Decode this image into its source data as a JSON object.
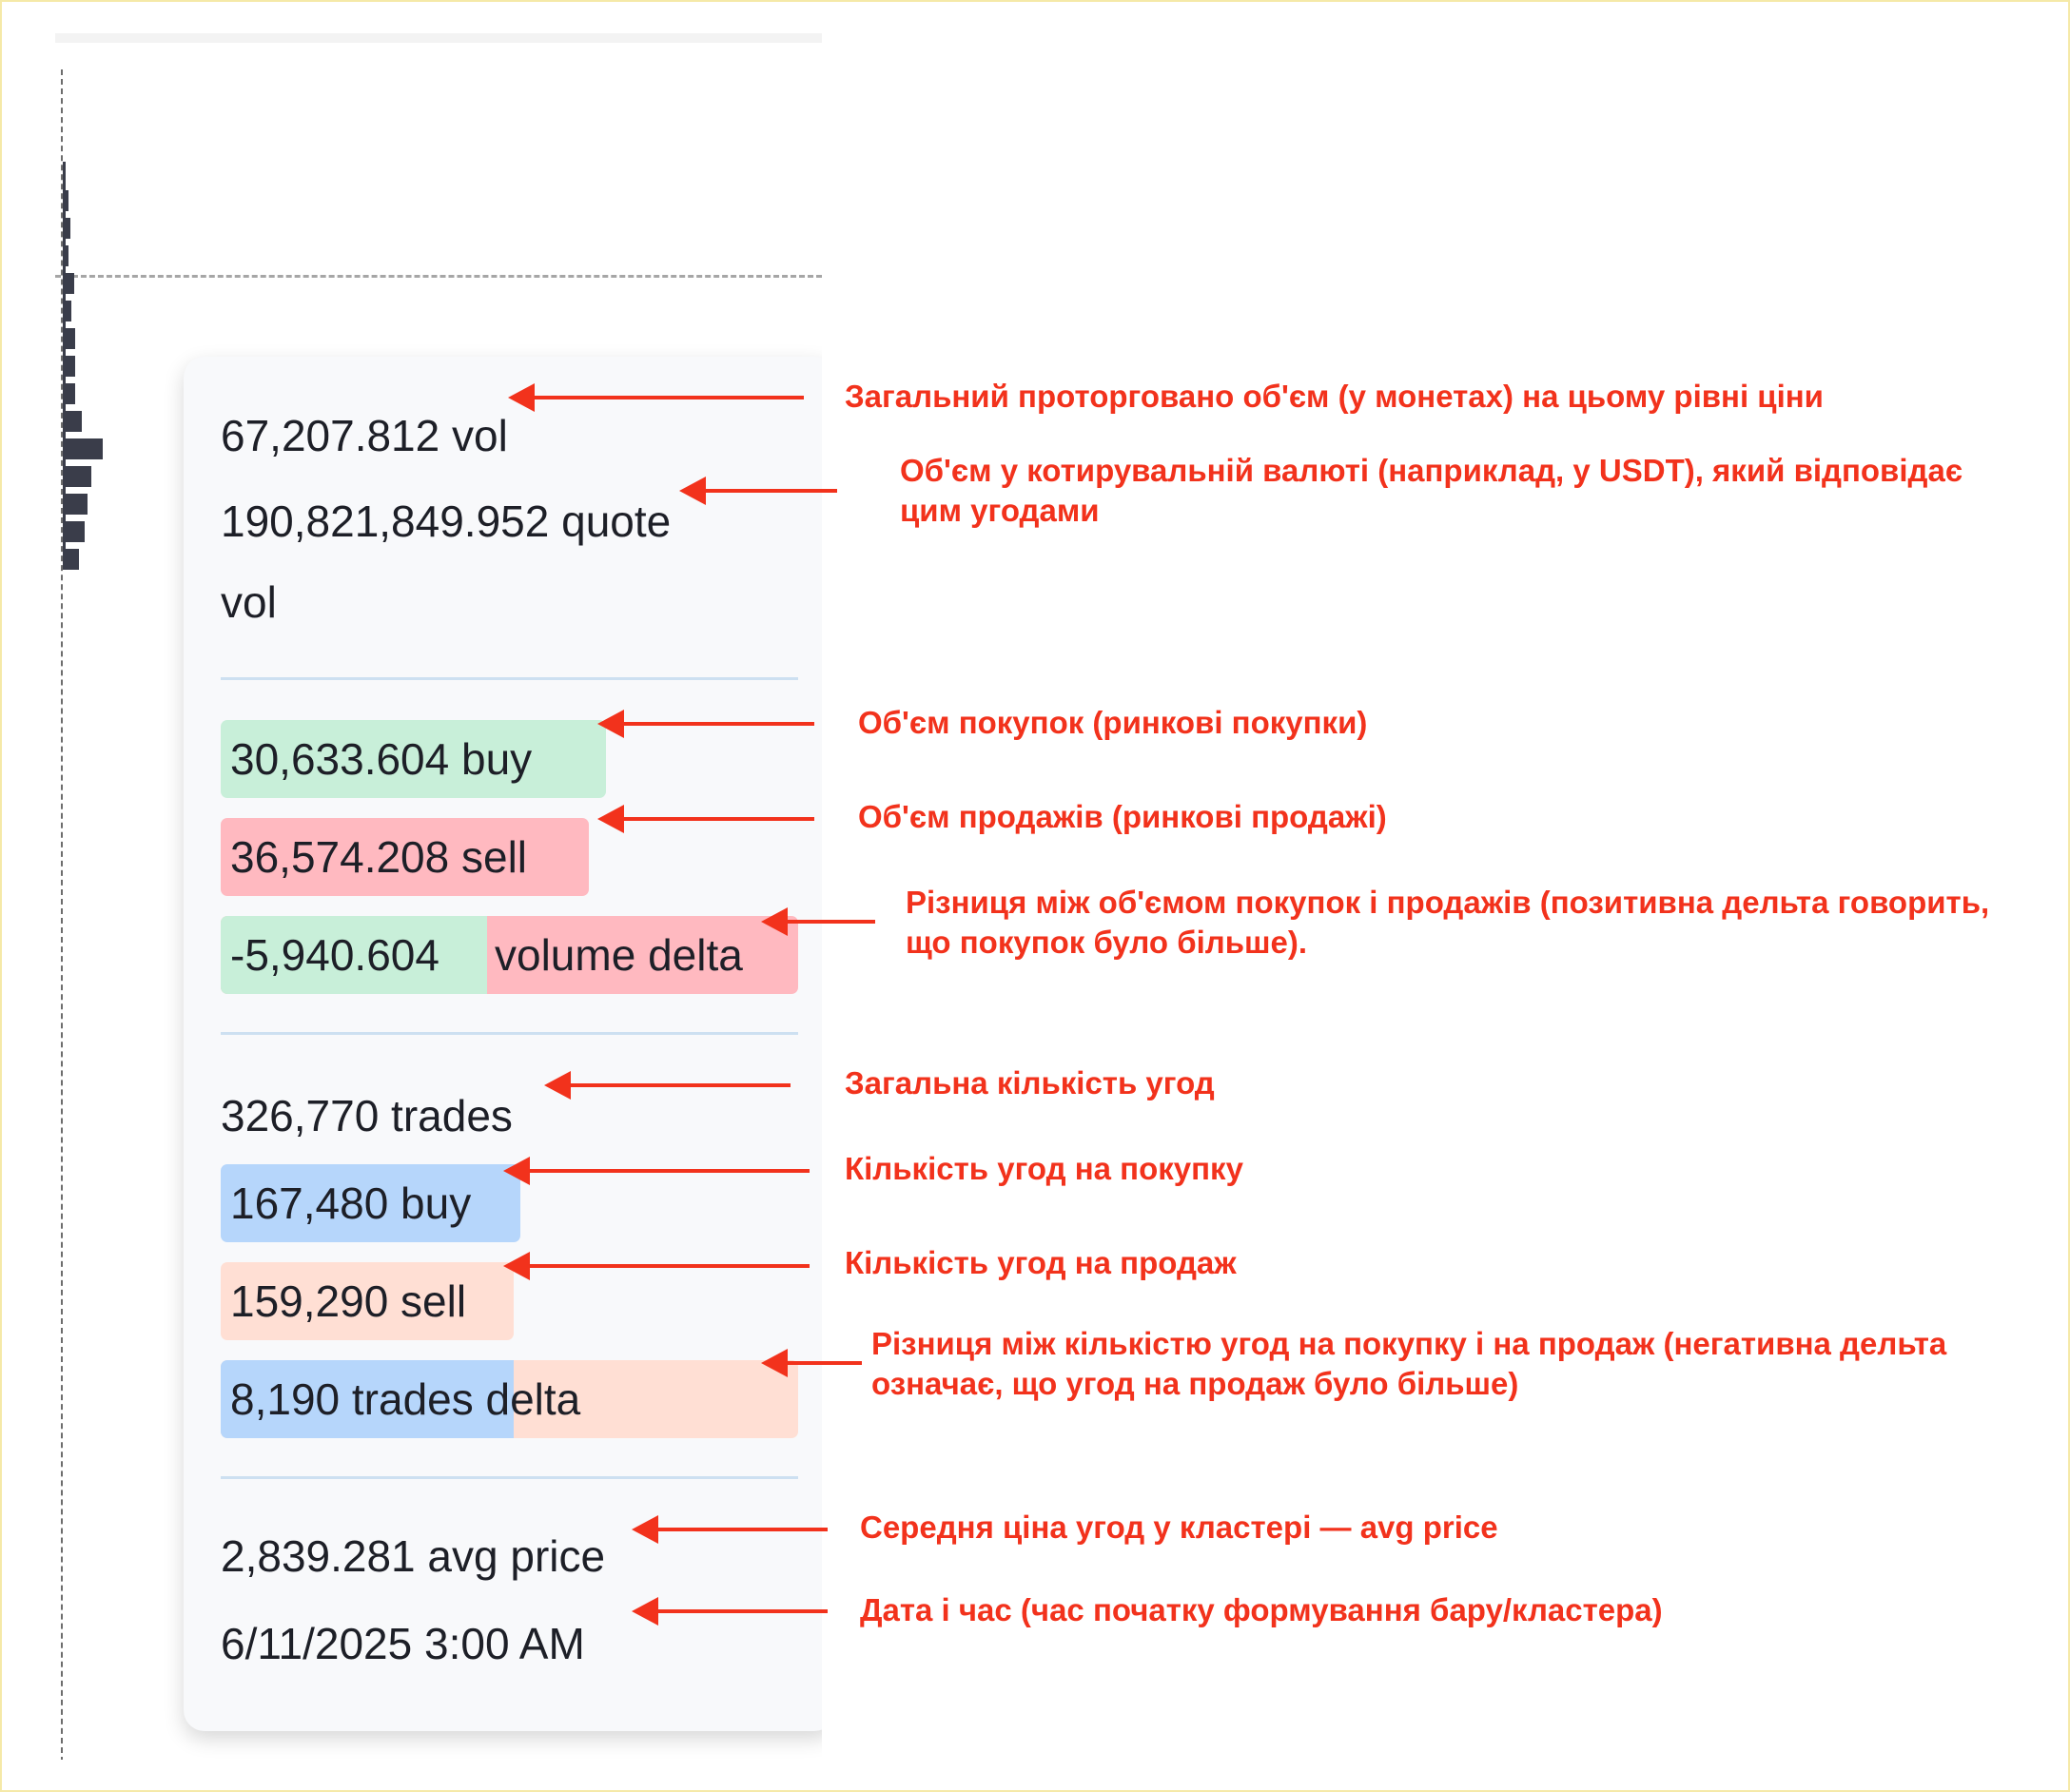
{
  "tooltip": {
    "vol": "67,207.812 vol",
    "quote_vol_line1": "190,821,849.952 quote",
    "quote_vol_line2": "vol",
    "buy_volume": "30,633.604 buy",
    "sell_volume": "36,574.208 sell",
    "volume_delta_value": "-5,940.604",
    "volume_delta_label": "volume delta",
    "trades": "326,770 trades",
    "buy_trades": "167,480 buy",
    "sell_trades": "159,290 sell",
    "trades_delta": "8,190 trades delta",
    "avg_price": "2,839.281 avg price",
    "datetime": "6/11/2025 3:00 AM"
  },
  "annotations": {
    "vol": "Загальний проторговано об'єм (у монетах) на цьому рівні ціни",
    "quote_vol_1": "Об'єм у котирувальній валюті (наприклад, у USDT), який відповідає",
    "quote_vol_2": "цим угодами",
    "buy_volume": "Об'єм покупок (ринкові покупки)",
    "sell_volume": "Об'єм продажів (ринкові продажі)",
    "volume_delta_1": "Різниця між об'ємом покупок і продажів (позитивна дельта говорить,",
    "volume_delta_2": "що покупок було більше).",
    "trades": "Загальна кількість угод",
    "buy_trades": "Кількість угод на покупку",
    "sell_trades": "Кількість угод на продаж",
    "trades_delta_1": "Різниця між кількістю угод на покупку і на продаж (негативна дельта",
    "trades_delta_2": "означає, що угод на продаж було більше)",
    "avg_price": "Середня ціна угод у кластері — avg price",
    "datetime": "Дата і час (час початку формування бару/кластера)"
  },
  "colors": {
    "annotation_red": "#f2321c",
    "buy_green": "#c8efd9",
    "sell_red": "#ffb9c0",
    "trades_buy_blue": "#b6d6fb",
    "trades_sell_peach": "#ffdfd4",
    "profile_bar": "#3a3d4a"
  },
  "volume_profile": [
    {
      "level": 1,
      "relative_volume": 0.12
    },
    {
      "level": 2,
      "relative_volume": 0.18
    },
    {
      "level": 3,
      "relative_volume": 0.12
    },
    {
      "level": 4,
      "relative_volume": 0.28
    },
    {
      "level": 5,
      "relative_volume": 0.22
    },
    {
      "level": 6,
      "relative_volume": 0.3
    },
    {
      "level": 7,
      "relative_volume": 0.3
    },
    {
      "level": 8,
      "relative_volume": 0.32
    },
    {
      "level": 9,
      "relative_volume": 0.48
    },
    {
      "level": 10,
      "relative_volume": 1.0
    },
    {
      "level": 11,
      "relative_volume": 0.72
    },
    {
      "level": 12,
      "relative_volume": 0.62
    },
    {
      "level": 13,
      "relative_volume": 0.55
    },
    {
      "level": 14,
      "relative_volume": 0.4
    }
  ]
}
